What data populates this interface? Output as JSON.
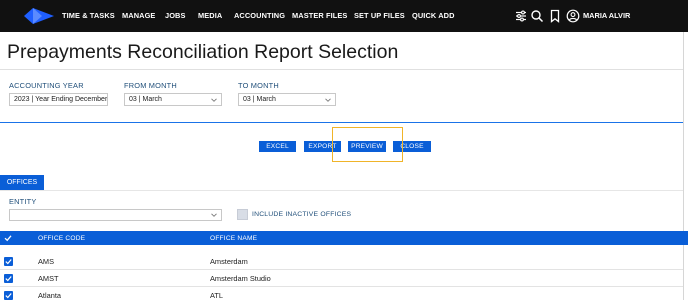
{
  "nav": {
    "items": [
      "TIME & TASKS",
      "MANAGE",
      "JOBS",
      "MEDIA",
      "ACCOUNTING",
      "MASTER FILES",
      "SET UP FILES",
      "QUICK ADD"
    ],
    "icons": [
      "filter-sliders-icon",
      "search-icon",
      "bookmark-icon",
      "user-icon"
    ],
    "user_name": "MARIA ALVIR"
  },
  "page": {
    "title": "Prepayments Reconciliation Report Selection"
  },
  "filters": {
    "accounting_year": {
      "label": "ACCOUNTING YEAR",
      "value": "2023 | Year Ending December"
    },
    "from_month": {
      "label": "FROM MONTH",
      "value": "03 | March"
    },
    "to_month": {
      "label": "TO MONTH",
      "value": "03 | March"
    }
  },
  "actions": {
    "excel": "EXCEL",
    "export": "EXPORT",
    "preview": "PREVIEW",
    "close": "CLOSE"
  },
  "tabs": {
    "offices": "OFFICES"
  },
  "entity": {
    "label": "ENTITY",
    "value": ""
  },
  "include_inactive": {
    "label": "INCLUDE INACTIVE OFFICES",
    "checked": false
  },
  "table": {
    "columns": [
      "OFFICE CODE",
      "OFFICE NAME"
    ],
    "rows": [
      {
        "code": "AMS",
        "name": "Amsterdam",
        "checked": true
      },
      {
        "code": "AMST",
        "name": "Amsterdam Studio",
        "checked": true
      },
      {
        "code": "Atlanta",
        "name": "ATL",
        "checked": true
      }
    ]
  },
  "colors": {
    "nav_bg": "#111111",
    "accent_blue": "#0a5ed7",
    "focus_outline": "#f0b429",
    "label_blue": "#1f4e79"
  }
}
